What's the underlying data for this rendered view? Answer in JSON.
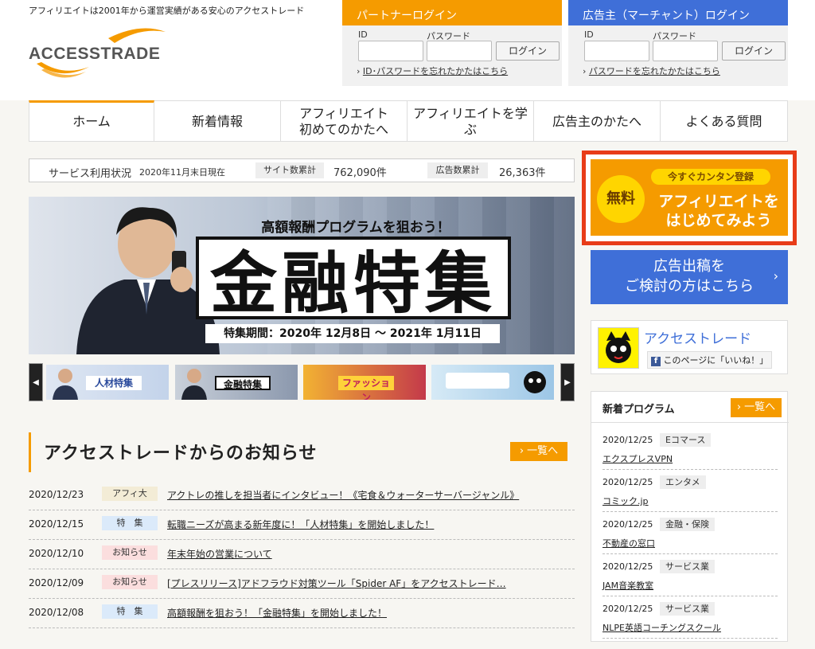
{
  "header": {
    "tagline": "アフィリエイトは2001年から運営実績がある安心のアクセストレード",
    "logo_text": "ACCESSTRADE"
  },
  "partner_login": {
    "title": "パートナーログイン",
    "id_label": "ID",
    "pw_label": "パスワード",
    "button": "ログイン",
    "forgot_prefix": "›",
    "forgot": "ID･パスワードを忘れたかたはこちら"
  },
  "merchant_login": {
    "title": "広告主（マーチャント）ログイン",
    "id_label": "ID",
    "pw_label": "パスワード",
    "button": "ログイン",
    "forgot_prefix": "›",
    "forgot": "パスワードを忘れたかたはこちら"
  },
  "nav": {
    "home": "ホーム",
    "news": "新着情報",
    "first_line1": "アフィリエイト",
    "first_line2": "初めてのかたへ",
    "learn": "アフィリエイトを学ぶ",
    "advertiser": "広告主のかたへ",
    "faq": "よくある質問"
  },
  "status": {
    "label": "サービス利用状況",
    "date": "2020年11月末日現在",
    "sites_label": "サイト数累計",
    "sites_value": "762,090件",
    "ads_label": "広告数累計",
    "ads_value": "26,363件"
  },
  "hero": {
    "subtitle": "高額報酬プログラムを狙おう！",
    "title": "金融特集",
    "period": "特集期間：2020年 12月8日 〜 2021年 1月11日"
  },
  "carousel": {
    "prev": "◀",
    "next": "▶",
    "thumbs": [
      "人材特集",
      "金融特集",
      "ファッション",
      ""
    ]
  },
  "news": {
    "title": "アクセストレードからのお知らせ",
    "more": "› 一覧へ",
    "items": [
      {
        "date": "2020/12/23",
        "cat": "アフィ大",
        "title": "アクトレの推しを担当者にインタビュー！《宅食＆ウォーターサーバージャンル》"
      },
      {
        "date": "2020/12/15",
        "cat": "特　集",
        "title": "転職ニーズが高まる新年度に！「人材特集」を開始しました！"
      },
      {
        "date": "2020/12/10",
        "cat": "お知らせ",
        "title": "年末年始の営業について"
      },
      {
        "date": "2020/12/09",
        "cat": "お知らせ",
        "title": "[プレスリリース]アドフラウド対策ツール「Spider AF」をアクセストレード…"
      },
      {
        "date": "2020/12/08",
        "cat": "特　集",
        "title": "高額報酬を狙おう！「金融特集」を開始しました！"
      }
    ]
  },
  "register": {
    "free": "無料",
    "pill": "今すぐカンタン登録",
    "line1": "アフィリエイトを",
    "line2": "はじめてみよう"
  },
  "advertise": {
    "line1": "広告出稿を",
    "line2": "ご検討の方はこちら",
    "chevron": "›"
  },
  "facebook": {
    "name": "アクセストレード",
    "like": "このページに「いいね！」"
  },
  "programs": {
    "title": "新着プログラム",
    "more": "› 一覧へ",
    "items": [
      {
        "date": "2020/12/25",
        "cat": "Eコマース",
        "name": "エクスプレスVPN"
      },
      {
        "date": "2020/12/25",
        "cat": "エンタメ",
        "name": "コミック.jp"
      },
      {
        "date": "2020/12/25",
        "cat": "金融・保険",
        "name": "不動産の窓口"
      },
      {
        "date": "2020/12/25",
        "cat": "サービス業",
        "name": "JAM音楽教室"
      },
      {
        "date": "2020/12/25",
        "cat": "サービス業",
        "name": "NLPE英語コーチングスクール"
      }
    ]
  },
  "colors": {
    "accent_orange": "#f59b00",
    "accent_blue": "#3f6fd8",
    "register_border": "#e83c18"
  }
}
